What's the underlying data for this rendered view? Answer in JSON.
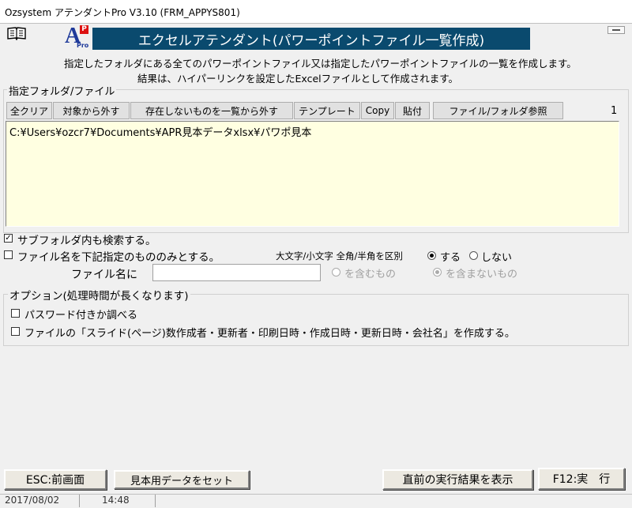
{
  "window": {
    "title": "Ozsystem アテンダントPro V3.10 (FRM_APPYS801)"
  },
  "header": {
    "banner": "エクセルアテンダント(パワーポイントファイル一覧作成)",
    "desc_line1": "指定したフォルダにある全てのパワーポイントファイル又は指定したパワーポイントファイルの一覧を作成します。",
    "desc_line2": "結果は、ハイパーリンクを設定したExcelファイルとして作成されます。",
    "logo_letter": "A",
    "logo_badge": "P",
    "logo_sub": "Pro"
  },
  "folder_section": {
    "legend": "指定フォルダ/ファイル",
    "buttons": {
      "clear_all": "全クリア",
      "remove": "対象から外す",
      "remove_missing": "存在しないものを一覧から外す",
      "template": "テンプレート",
      "copy": "Copy",
      "paste": "貼付",
      "browse": "ファイル/フォルダ参照"
    },
    "count": "1",
    "list_items": [
      "C:¥Users¥ozcr7¥Documents¥APR見本データxlsx¥パワポ見本"
    ]
  },
  "options": {
    "subfolder_label": "サブフォルダ内も検索する。",
    "subfolder_checked": true,
    "filename_only_label": "ファイル名を下記指定のもののみとする。",
    "case_label": "大文字/小文字 全角/半角を区別",
    "case_yes": "する",
    "case_no": "しない",
    "filename_label": "ファイル名に",
    "filename_value": "",
    "contains": "を含むもの",
    "not_contains": "を含まないもの"
  },
  "option_group": {
    "legend": "オプション(処理時間が長くなります)",
    "password_label": "パスワード付きか調べる",
    "detail_label": "ファイルの「スライド(ページ)数作成者・更新者・印刷日時・作成日時・更新日時・会社名」を作成する。"
  },
  "footer": {
    "esc": "ESC:前画面",
    "sample": "見本用データをセット",
    "show_result": "直前の実行結果を表示",
    "run": "F12:実　行"
  },
  "status": {
    "date": "2017/08/02",
    "time": "14:48"
  }
}
